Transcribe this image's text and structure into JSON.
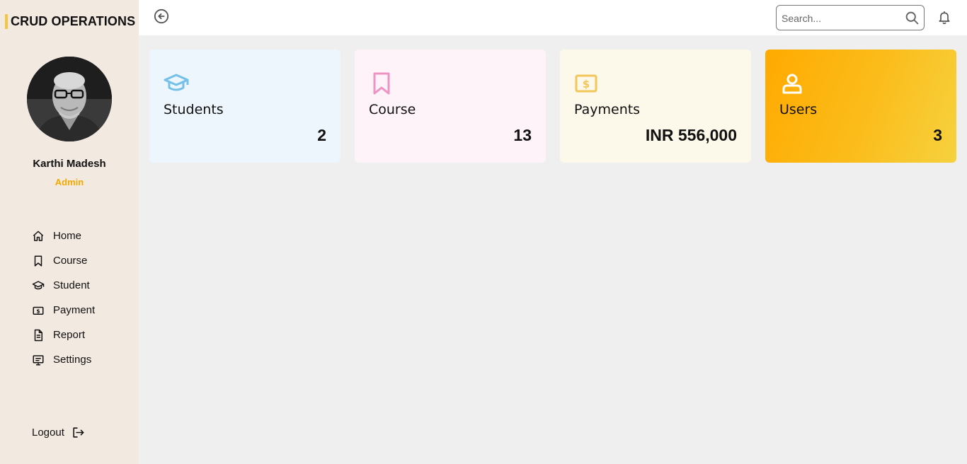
{
  "brand": {
    "title": "CRUD OPERATIONS",
    "accent_color": "#f5c542"
  },
  "profile": {
    "name": "Karthi Madesh",
    "role": "Admin",
    "role_color": "#f5a800"
  },
  "nav": {
    "items": [
      {
        "label": "Home",
        "icon": "home-icon"
      },
      {
        "label": "Course",
        "icon": "bookmark-icon"
      },
      {
        "label": "Student",
        "icon": "graduation-cap-icon"
      },
      {
        "label": "Payment",
        "icon": "dollar-bill-icon"
      },
      {
        "label": "Report",
        "icon": "document-icon"
      },
      {
        "label": "Settings",
        "icon": "settings-panel-icon"
      }
    ]
  },
  "logout": {
    "label": "Logout",
    "icon": "logout-icon"
  },
  "topbar": {
    "back_icon": "arrow-left-circle-icon",
    "search": {
      "placeholder": "Search...",
      "value": ""
    },
    "notification_icon": "bell-icon"
  },
  "cards": {
    "students": {
      "title": "Students",
      "value": "2",
      "icon": "graduation-cap-icon",
      "bg": "#eef6fd",
      "icon_color": "#74c0e8"
    },
    "course": {
      "title": "Course",
      "value": "13",
      "icon": "bookmark-icon",
      "bg": "#fdf3f9",
      "icon_color": "#ee93c3"
    },
    "payments": {
      "title": "Payments",
      "value": "INR 556,000",
      "icon": "dollar-bill-icon",
      "bg": "#fcf9ea",
      "icon_color": "#f2c65a"
    },
    "users": {
      "title": "Users",
      "value": "3",
      "icon": "user-icon",
      "bg": "#ffaa00",
      "icon_color": "#ffffff"
    }
  }
}
